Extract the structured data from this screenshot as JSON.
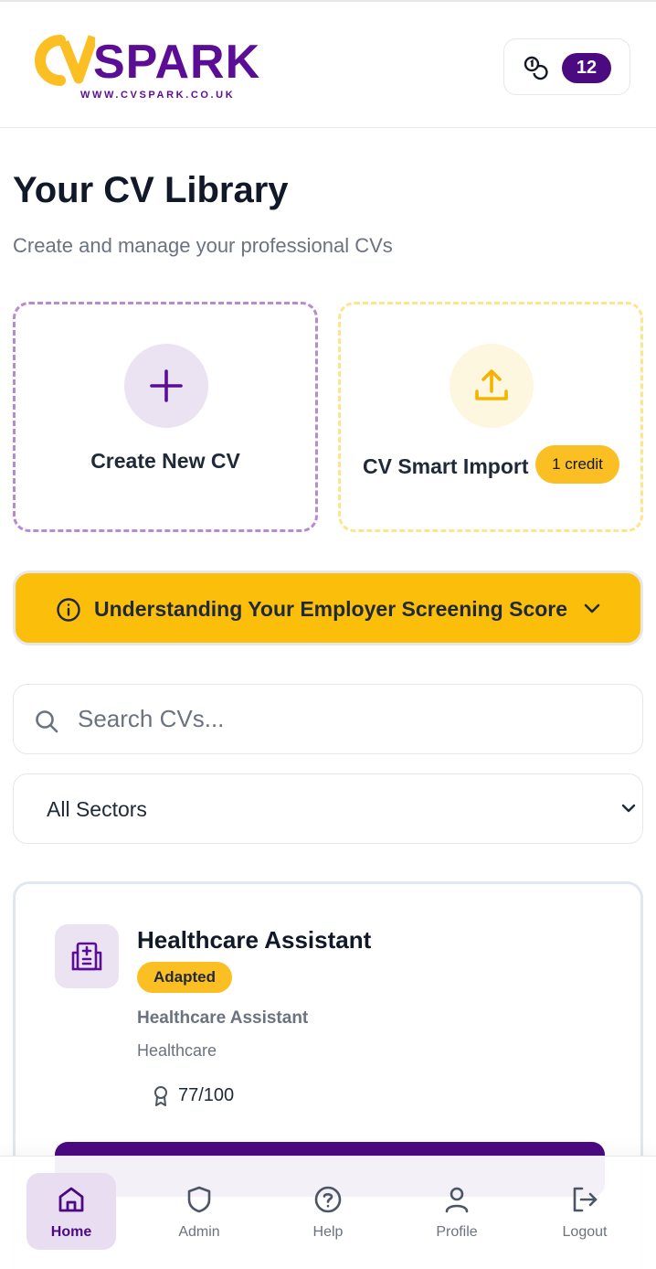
{
  "header": {
    "brand_name": "SPARK",
    "brand_url": "WWW.CVSPARK.CO.UK",
    "credits_count": "12",
    "brand_purple": "#5b0d96",
    "brand_yellow": "#fbbf24"
  },
  "page": {
    "title": "Your CV Library",
    "subtitle": "Create and manage your professional CVs"
  },
  "actions": {
    "create_label": "Create New CV",
    "import_label": "CV Smart Import",
    "import_badge": "1 credit"
  },
  "banner": {
    "text": "Understanding Your Employer Screening Score"
  },
  "search": {
    "placeholder": "Search CVs..."
  },
  "filter": {
    "selected": "All Sectors"
  },
  "cv_cards": [
    {
      "title": "Healthcare Assistant",
      "badge": "Adapted",
      "role": "Healthcare Assistant",
      "sector": "Healthcare",
      "score": "77/100"
    }
  ],
  "nav": {
    "items": [
      {
        "label": "Home",
        "icon": "home-icon",
        "active": true
      },
      {
        "label": "Admin",
        "icon": "shield-icon",
        "active": false
      },
      {
        "label": "Help",
        "icon": "help-circle-icon",
        "active": false
      },
      {
        "label": "Profile",
        "icon": "user-icon",
        "active": false
      },
      {
        "label": "Logout",
        "icon": "logout-icon",
        "active": false
      }
    ]
  }
}
